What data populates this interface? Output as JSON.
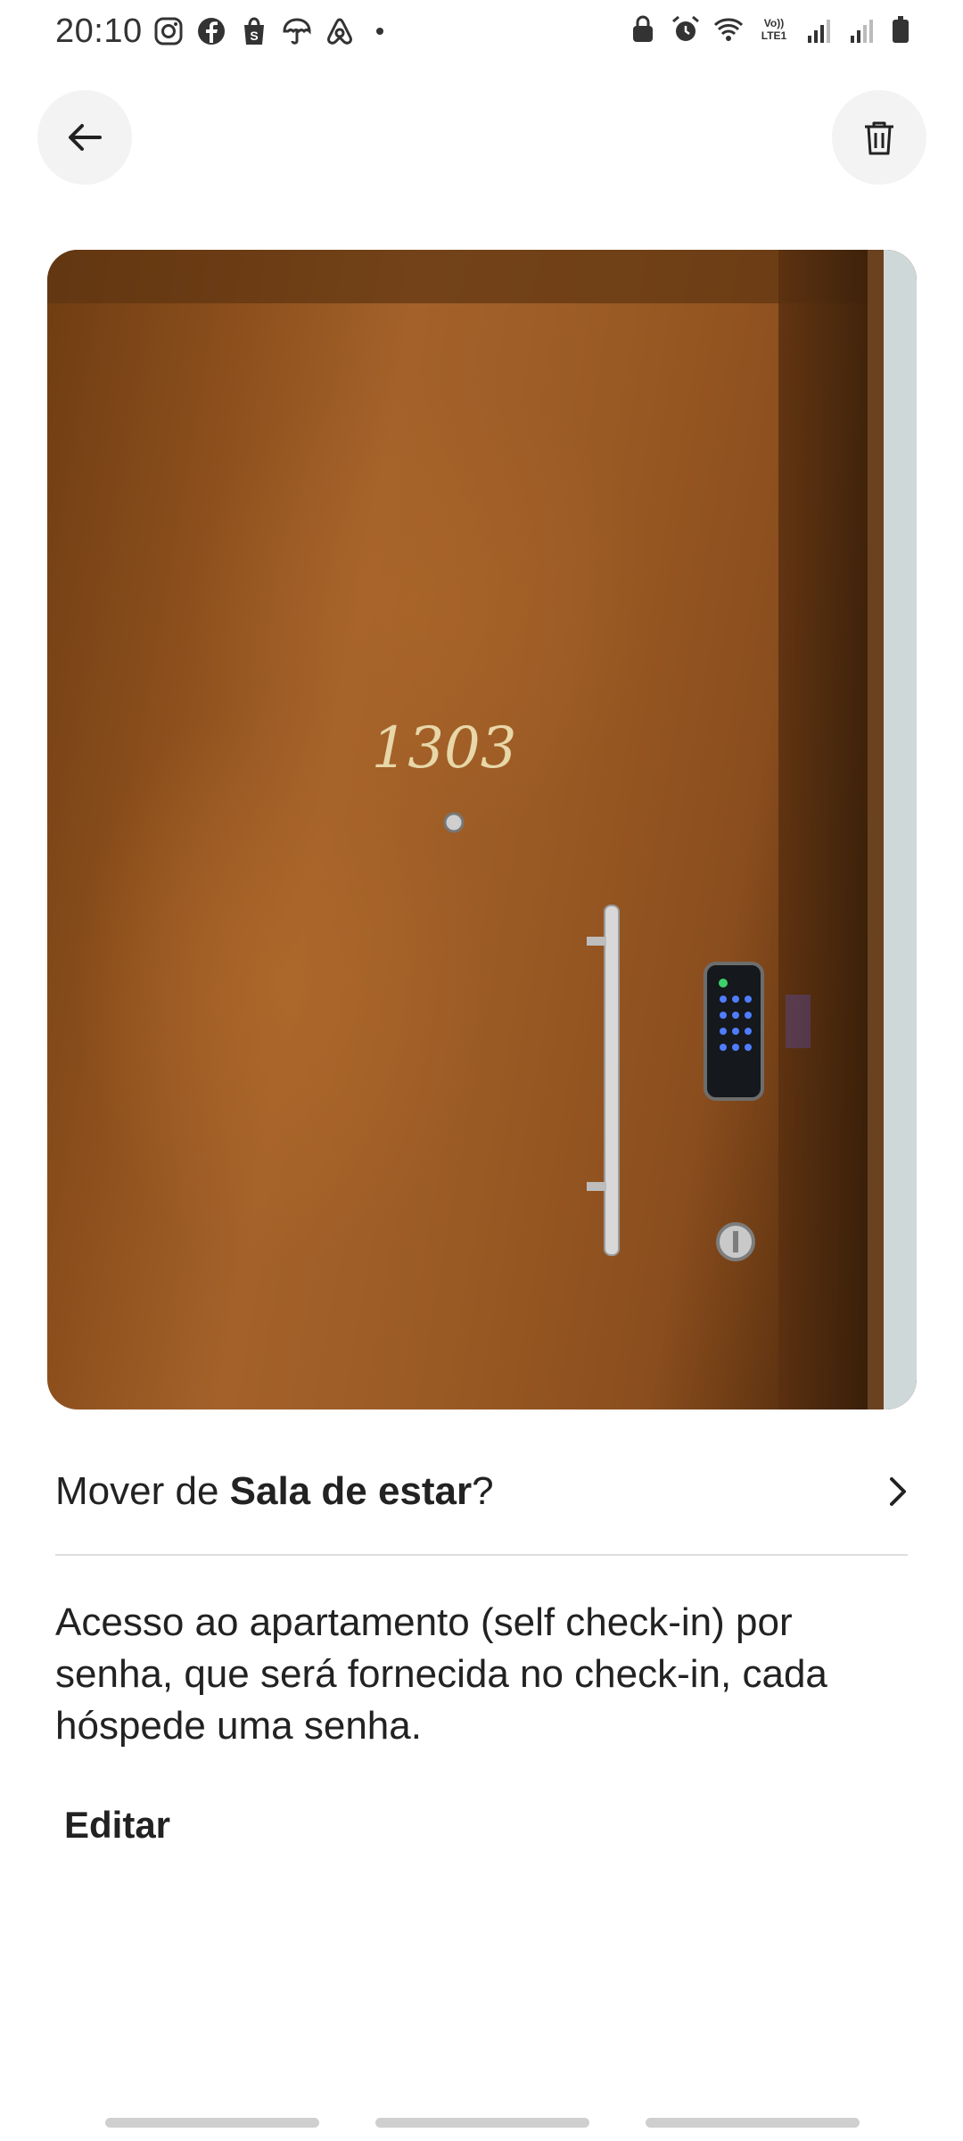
{
  "status_bar": {
    "time": "20:10",
    "left_icons": [
      "instagram-icon",
      "facebook-icon",
      "shopify-icon",
      "umbrella-icon",
      "airbnb-icon"
    ],
    "right_icons": [
      "lock-icon",
      "alarm-icon",
      "wifi-icon",
      "volte-icon",
      "signal-icon",
      "battery-icon"
    ],
    "volte_label": "Vo)) LTE1"
  },
  "header": {
    "back_icon": "arrow-left-icon",
    "delete_icon": "trash-icon"
  },
  "photo": {
    "door_number": "1303"
  },
  "move_row": {
    "prefix": "Mover de ",
    "room": "Sala de estar",
    "suffix": "?"
  },
  "description": "Acesso ao apartamento (self check-in) por senha, que será fornecida no check-in, cada hóspede uma senha.",
  "edit_label": "Editar",
  "colors": {
    "door_wood": "#8b4e1c",
    "button_bg": "#f3f3f3",
    "divider": "#dddddd",
    "text": "#222222"
  }
}
